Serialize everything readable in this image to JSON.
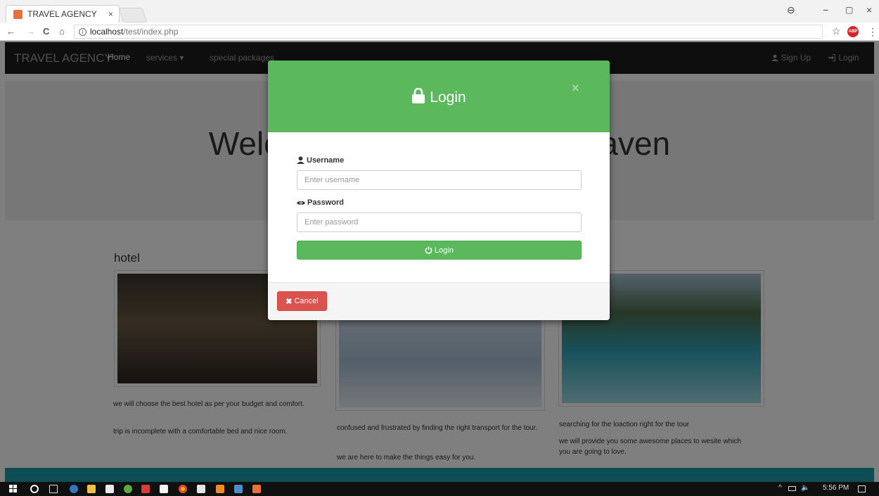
{
  "browser": {
    "tab_title": "TRAVEL AGENCY",
    "tab_close": "×",
    "url_host": "localhost",
    "url_path": "/test/index.php",
    "back": "←",
    "forward": "→",
    "reload": "C",
    "home": "⌂",
    "star": "☆",
    "abp_label": "ABP",
    "menu": "⋮",
    "profile": "⊖",
    "minimize": "−",
    "restore": "▢",
    "close": "×"
  },
  "navbar": {
    "brand": "TRAVEL AGENCY",
    "home": "Home",
    "services": "services ▾",
    "special": "special packages",
    "signup": "Sign Up",
    "login": "Login"
  },
  "jumbotron": {
    "heading": "Welcome to the ultimate heaven"
  },
  "columns": [
    {
      "heading": "hotel",
      "text1": "we will choose the best hotel as per your budget and comfort.",
      "text2": "trip is incomplete with a comfortable bed and nice room."
    },
    {
      "heading": "",
      "text1": "confused and frustrated by finding the right transport for the tour.",
      "text2": "we are here to make the things easy for you."
    },
    {
      "heading": "",
      "text1": "searching for the loaction right for the tour",
      "text2": "we will provide you some awesome places to wesite which you are going to love."
    }
  ],
  "modal": {
    "title": "Login",
    "close": "×",
    "username_label": "Username",
    "username_placeholder": "Enter username",
    "password_label": "Password",
    "password_placeholder": "Enter password",
    "submit": "Login",
    "cancel": "Cancel",
    "cancel_icon": "✖"
  },
  "taskbar": {
    "time": "5:56 PM",
    "tray_chevron": "^",
    "volume": "🔈"
  },
  "colors": {
    "success": "#5cb85c",
    "danger": "#d9534f",
    "navbar": "#1d1d1d",
    "footer": "#1a9aa6"
  }
}
